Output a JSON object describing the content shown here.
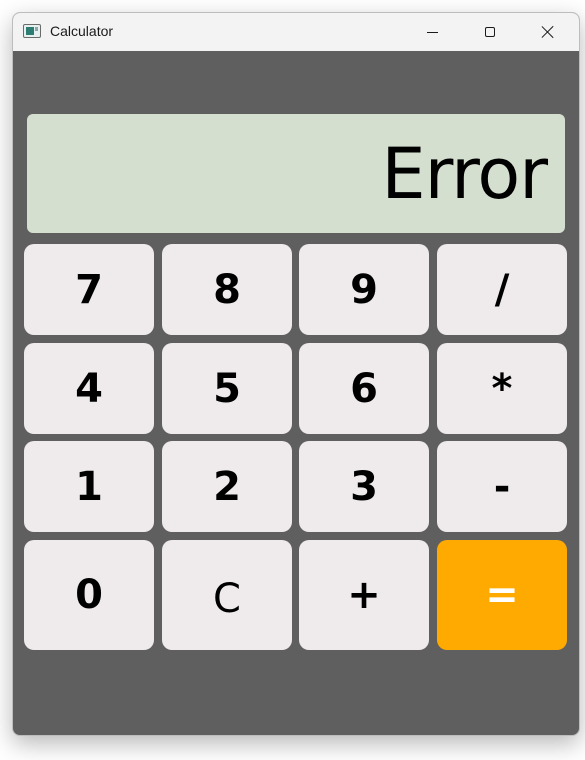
{
  "window": {
    "title": "Calculator",
    "icon": "calculator-app-icon",
    "controls": [
      "minimize-icon",
      "maximize-icon",
      "close-icon"
    ]
  },
  "display": {
    "value": "Error"
  },
  "keys": {
    "row1": [
      "7",
      "8",
      "9",
      "/"
    ],
    "row2": [
      "4",
      "5",
      "6",
      "*"
    ],
    "row3": [
      "1",
      "2",
      "3",
      "-"
    ],
    "row4": [
      "0",
      "C",
      "+",
      "="
    ]
  },
  "colors": {
    "background": "#5f5f5f",
    "display_bg": "#d5dfd0",
    "key_bg": "#efebec",
    "equals_bg": "#ffaa00",
    "equals_text": "#ffffff"
  }
}
